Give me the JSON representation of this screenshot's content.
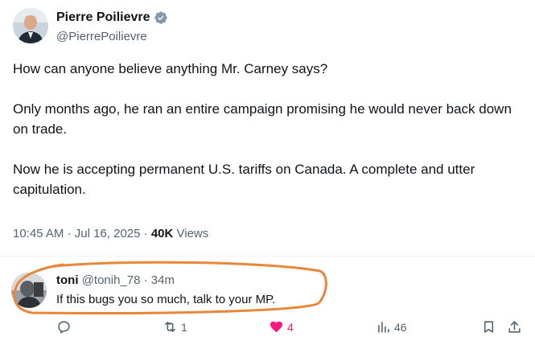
{
  "tweet": {
    "author_name": "Pierre Poilievre",
    "author_handle": "@PierrePoilievre",
    "verified": true,
    "paragraphs": [
      "How can anyone believe anything Mr. Carney says?",
      "Only months ago, he ran an entire campaign promising he would never back down on trade.",
      "Now he is accepting permanent U.S. tariffs on Canada. A complete and utter capitulation."
    ],
    "time": "10:45 AM",
    "separator": "·",
    "date": "Jul 16, 2025",
    "views_count": "40K",
    "views_label": "Views"
  },
  "reply": {
    "name": "toni",
    "handle": "@tonih_78",
    "separator": "·",
    "time": "34m",
    "text": "If this bugs you so much, talk to your MP.",
    "highlight_color": "#e8873a",
    "actions": {
      "reply_count": "",
      "retweet_count": "1",
      "like_count": "4",
      "views_count": "46"
    }
  },
  "icons": [
    "verified-badge-icon",
    "reply-icon",
    "retweet-icon",
    "heart-icon",
    "views-icon",
    "bookmark-icon",
    "share-icon"
  ],
  "colors": {
    "text": "#0f1419",
    "secondary": "#536471",
    "verified": "#829aab",
    "like": "#f91880"
  }
}
